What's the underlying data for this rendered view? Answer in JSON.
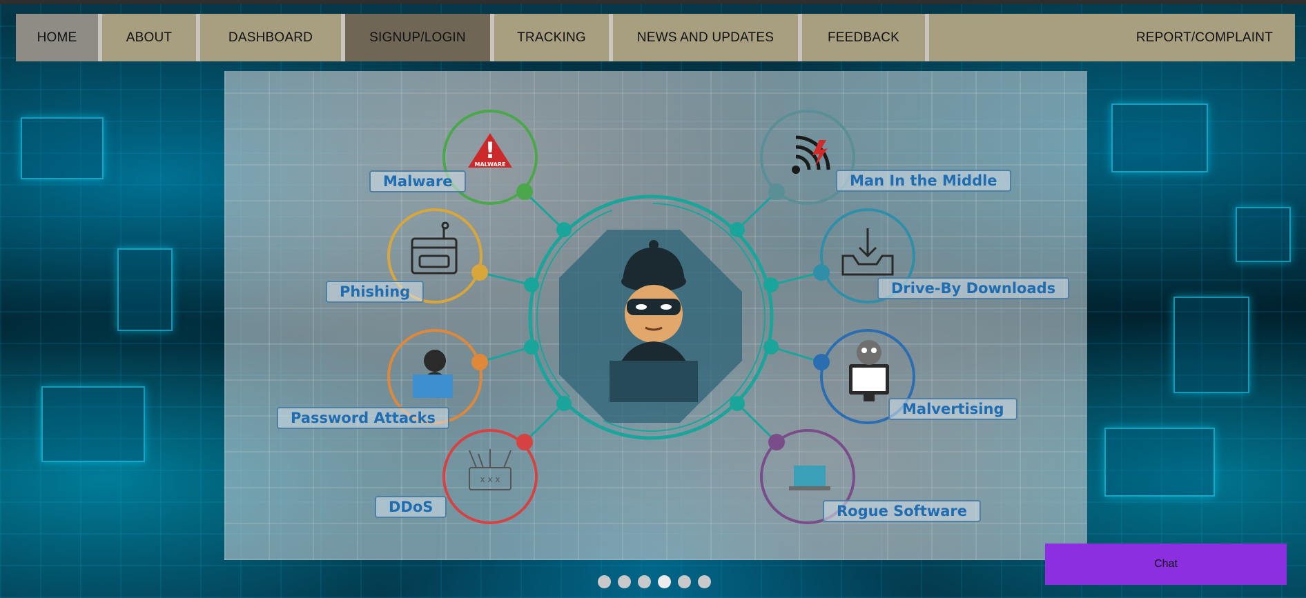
{
  "nav": {
    "items": [
      {
        "label": "HOME"
      },
      {
        "label": "ABOUT"
      },
      {
        "label": "DASHBOARD"
      },
      {
        "label": "SIGNUP/LOGIN"
      },
      {
        "label": "TRACKING"
      },
      {
        "label": "NEWS AND UPDATES"
      },
      {
        "label": "FEEDBACK"
      },
      {
        "label": "REPORT/COMPLAINT"
      }
    ]
  },
  "slide": {
    "labels": {
      "malware": "Malware",
      "mitm": "Man In the Middle",
      "phishing": "Phishing",
      "driveby": "Drive-By Downloads",
      "password": "Password Attacks",
      "malvertising": "Malvertising",
      "ddos": "DDoS",
      "rogue": "Rogue Software"
    },
    "warning_icon_text": "MALWARE"
  },
  "carousel": {
    "slide_count": 6,
    "active_index": 3
  },
  "chat": {
    "label": "Chat"
  },
  "colors": {
    "nav_bg": "#a89e80",
    "nav_active": "#6f6656",
    "chat_bg": "#8b2fe0",
    "label_text": "#1f6cb0",
    "ring_teal": "#1aa59b"
  },
  "icons": [
    "warning-icon",
    "wifi-attack-icon",
    "browser-password-icon",
    "download-tray-icon",
    "hacker-laptop-icon",
    "monitor-virus-icon",
    "network-disruption-icon",
    "rogue-laptop-icon",
    "hacker-avatar-icon"
  ]
}
